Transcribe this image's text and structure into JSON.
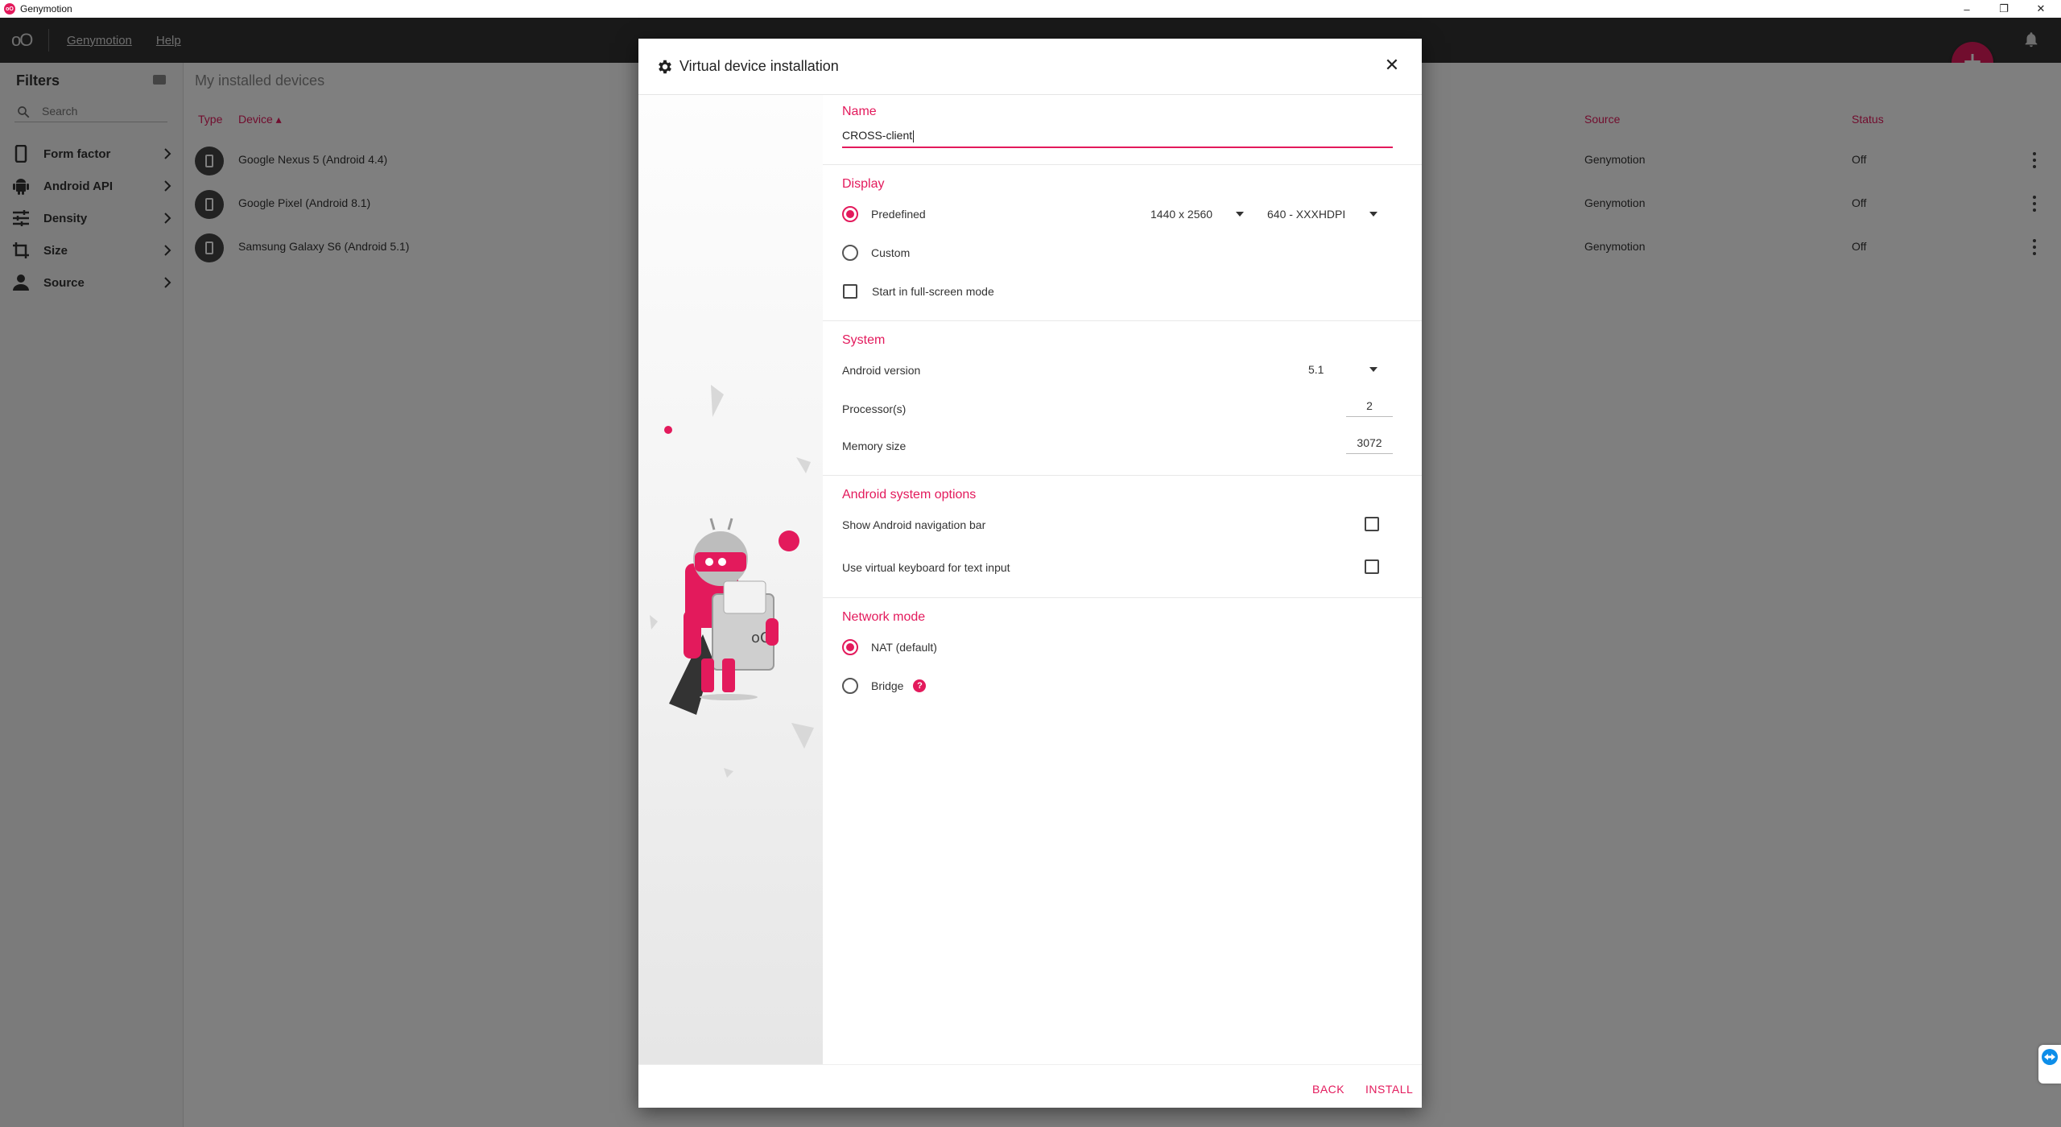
{
  "window": {
    "title": "Genymotion",
    "logo_text": "oO",
    "controls": [
      "–",
      "❐",
      "✕"
    ]
  },
  "toolbar": {
    "logo": "oO",
    "menu": [
      "Genymotion",
      "Help"
    ],
    "add_icon": "plus-icon",
    "bell_icon": "bell-icon"
  },
  "sidebar": {
    "title": "Filters",
    "search_placeholder": "Search",
    "items": [
      {
        "label": "Form factor",
        "icon": "phone-icon"
      },
      {
        "label": "Android API",
        "icon": "android-icon"
      },
      {
        "label": "Density",
        "icon": "sliders-icon"
      },
      {
        "label": "Size",
        "icon": "crop-icon"
      },
      {
        "label": "Source",
        "icon": "person-icon"
      }
    ]
  },
  "main": {
    "title": "My installed devices",
    "columns": {
      "type": "Type",
      "device": "Device ▴",
      "source": "Source",
      "status": "Status"
    },
    "rows": [
      {
        "name": "Google Nexus 5 (Android 4.4)",
        "source": "Genymotion",
        "status": "Off"
      },
      {
        "name": "Google Pixel (Android 8.1)",
        "source": "Genymotion",
        "status": "Off"
      },
      {
        "name": "Samsung Galaxy S6 (Android 5.1)",
        "source": "Genymotion",
        "status": "Off"
      }
    ]
  },
  "dialog": {
    "title": "Virtual device installation",
    "close": "✕",
    "name": {
      "label": "Name",
      "value": "CROSS-client"
    },
    "display": {
      "label": "Display",
      "predefined": "Predefined",
      "custom": "Custom",
      "resolution": "1440 x 2560",
      "density": "640 - XXXHDPI",
      "fullscreen": "Start in full-screen mode",
      "selected": "Predefined"
    },
    "system": {
      "label": "System",
      "android_version_label": "Android version",
      "android_version": "5.1",
      "processors_label": "Processor(s)",
      "processors": "2",
      "memory_label": "Memory size",
      "memory": "3072"
    },
    "android_options": {
      "label": "Android system options",
      "nav_bar": "Show Android navigation bar",
      "virtual_keyboard": "Use virtual keyboard for text input"
    },
    "network": {
      "label": "Network mode",
      "nat": "NAT (default)",
      "bridge": "Bridge",
      "help": "?",
      "selected": "NAT (default)"
    },
    "buttons": {
      "back": "BACK",
      "install": "INSTALL"
    }
  },
  "colors": {
    "accent": "#e31a5c",
    "toolbar": "#333333"
  }
}
